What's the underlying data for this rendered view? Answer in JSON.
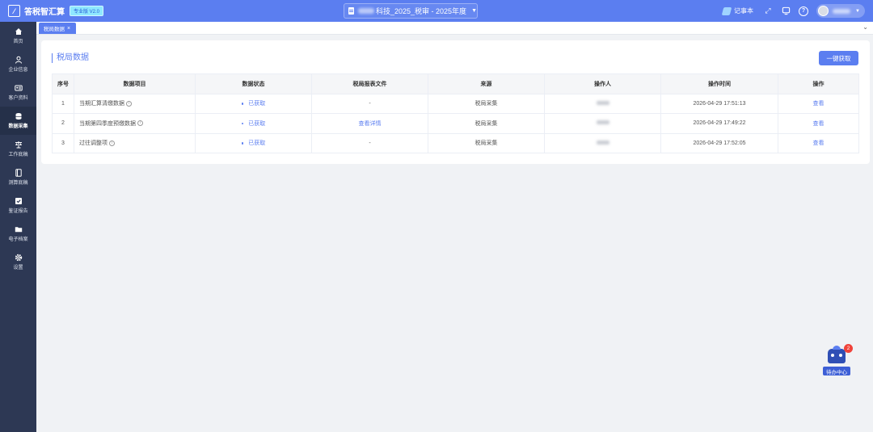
{
  "app": {
    "name": "答税智汇算",
    "edition": "专业版 V2.0"
  },
  "project": {
    "title": "科技_2025_税审 - 2025年度"
  },
  "topbar": {
    "notebook_label": "记事本"
  },
  "sidebar": {
    "items": [
      {
        "label": "首页",
        "icon": "home-icon"
      },
      {
        "label": "企业信息",
        "icon": "person-icon"
      },
      {
        "label": "客户资料",
        "icon": "id-card-icon"
      },
      {
        "label": "数据采集",
        "icon": "database-icon",
        "active": true
      },
      {
        "label": "工作底稿",
        "icon": "scale-icon"
      },
      {
        "label": "测算底稿",
        "icon": "calc-icon"
      },
      {
        "label": "鉴证报告",
        "icon": "check-icon"
      },
      {
        "label": "电子档案",
        "icon": "folder-icon"
      },
      {
        "label": "设置",
        "icon": "gear-icon"
      }
    ]
  },
  "tabs": [
    {
      "label": "税局数据"
    }
  ],
  "card": {
    "title": "税局数据",
    "fetch_all_label": "一键获取"
  },
  "table": {
    "columns": [
      "序号",
      "数据项目",
      "数据状态",
      "税局报表文件",
      "来源",
      "操作人",
      "操作时间",
      "操作"
    ],
    "rows": [
      {
        "index": "1",
        "item": "当期汇算清缴数据",
        "status": "已获取",
        "file": "-",
        "source": "税局采集",
        "time": "2026-04-29 17:51:13",
        "action": "查看"
      },
      {
        "index": "2",
        "item": "当期第四季度预缴数据",
        "status": "已获取",
        "file": "查看详情",
        "source": "税局采集",
        "time": "2026-04-29 17:49:22",
        "action": "查看"
      },
      {
        "index": "3",
        "item": "过往调整项",
        "status": "已获取",
        "file": "-",
        "source": "税局采集",
        "time": "2026-04-29 17:52:05",
        "action": "查看"
      }
    ]
  },
  "todo": {
    "label": "待办中心",
    "badge": "2"
  },
  "colors": {
    "primary": "#5b7ef0",
    "sidebar_bg": "#2d3854",
    "badge": "#f0433a"
  }
}
